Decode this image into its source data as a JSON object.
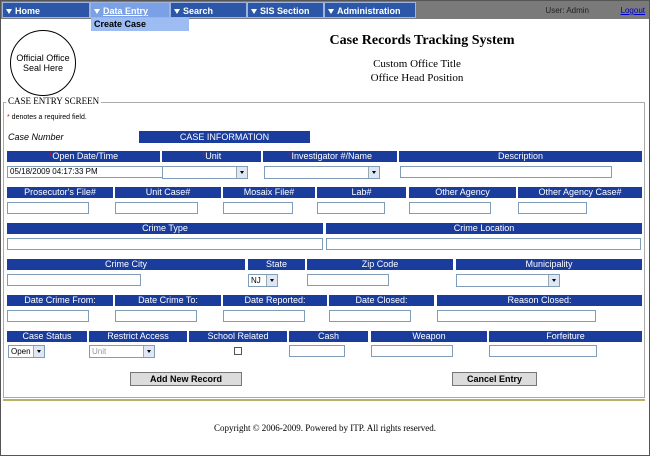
{
  "nav": {
    "items": [
      "Home",
      "Data Entry",
      "Search",
      "SIS Section",
      "Administration"
    ],
    "dropdown_item": "Create Case",
    "user": "User: Admin",
    "logout": "Logout"
  },
  "header": {
    "seal_text": "Official Office Seal Here",
    "title": "Case Records Tracking System",
    "subtitle1": "Custom Office Title",
    "subtitle2": "Office Head Position"
  },
  "form": {
    "legend": "CASE ENTRY SCREEN",
    "req_star": "*",
    "req_note": " denotes a required field.",
    "case_number_label": "Case Number",
    "case_info_label": "CASE INFORMATION",
    "row1": {
      "open_date_label": "Open Date/Time",
      "unit_label": "Unit",
      "investigator_label": "Investigator #/Name",
      "description_label": "Description",
      "open_date_value": "05/18/2009 04:17:33 PM"
    },
    "row2": {
      "labels": [
        "Prosecutor's File#",
        "Unit Case#",
        "Mosaix File#",
        "Lab#",
        "Other Agency",
        "Other Agency Case#"
      ]
    },
    "row3": {
      "crime_type_label": "Crime Type",
      "crime_location_label": "Crime Location"
    },
    "row4": {
      "crime_city_label": "Crime City",
      "state_label": "State",
      "zip_label": "Zip Code",
      "municipality_label": "Municipality",
      "state_value": "NJ"
    },
    "row5": {
      "labels": [
        "Date Crime From:",
        "Date Crime To:",
        "Date Reported:",
        "Date Closed:",
        "Reason Closed:"
      ]
    },
    "row6": {
      "labels": [
        "Case Status",
        "Restrict Access",
        "School Related",
        "Cash",
        "Weapon",
        "Forfeiture"
      ],
      "case_status_value": "Open",
      "restrict_access_value": "Unit"
    },
    "buttons": {
      "add": "Add New Record",
      "cancel": "Cancel Entry"
    }
  },
  "footer": {
    "copyright": "Copyright © 2006-2009. Powered by ITP.   All rights reserved."
  }
}
